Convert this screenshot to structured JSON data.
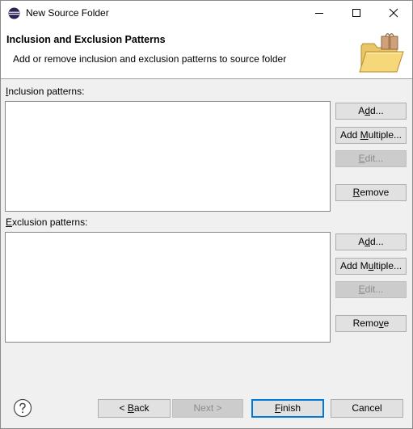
{
  "window": {
    "title": "New Source Folder"
  },
  "header": {
    "title": "Inclusion and Exclusion Patterns",
    "description": "Add or remove inclusion and exclusion patterns to source folder"
  },
  "inclusion": {
    "label_mnemonic": "I",
    "label_rest": "nclusion patterns:",
    "buttons": {
      "add_a": "A",
      "add_m": "d",
      "add_b": "d...",
      "addmult_a": "Add ",
      "addmult_m": "M",
      "addmult_b": "ultiple...",
      "edit_m": "E",
      "edit_b": "dit...",
      "remove_m": "R",
      "remove_b": "emove"
    }
  },
  "exclusion": {
    "label_mnemonic": "E",
    "label_rest": "xclusion patterns:",
    "buttons": {
      "add_a": "A",
      "add_m": "d",
      "add_b": "d...",
      "addmult_a": "Add M",
      "addmult_m": "u",
      "addmult_b": "ltiple...",
      "edit_m": "E",
      "edit_b": "dit...",
      "remove_a": "Remo",
      "remove_m": "v",
      "remove_b": "e"
    }
  },
  "footer": {
    "back_a": "< ",
    "back_m": "B",
    "back_b": "ack",
    "next": "Next >",
    "finish_m": "F",
    "finish_b": "inish",
    "cancel": "Cancel"
  },
  "colors": {
    "accent": "#0078d7",
    "disabled_text": "#8c8c8c"
  },
  "icons": {
    "app": "eclipse-icon",
    "header": "folder-package-icon",
    "help": "help-icon"
  }
}
